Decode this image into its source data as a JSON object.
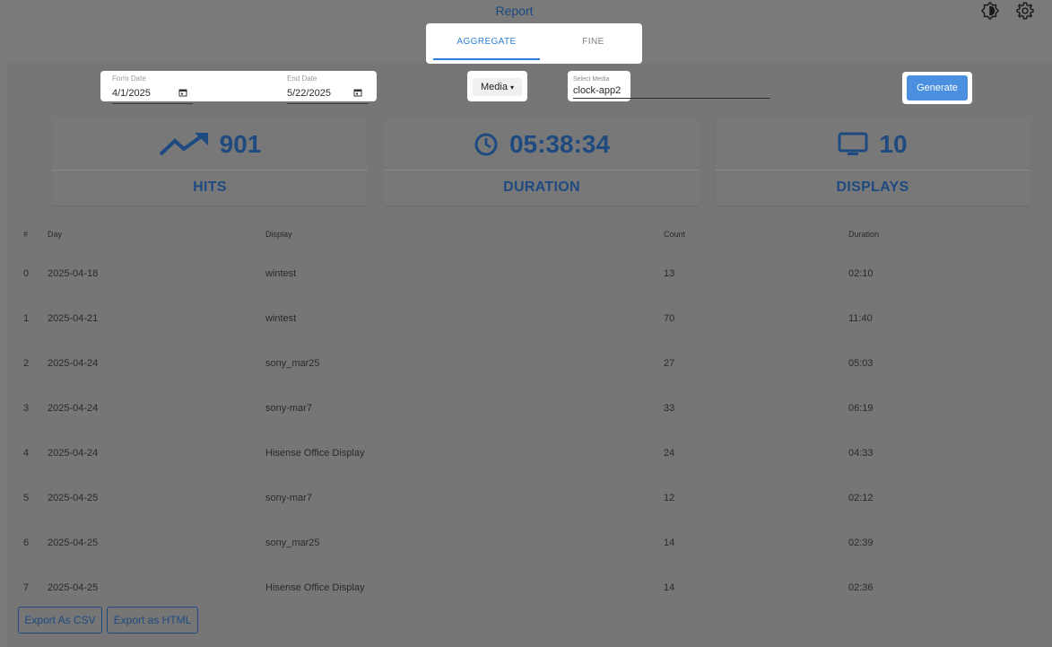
{
  "header": {
    "title": "Report",
    "theme_icon": "brightness-icon",
    "settings_icon": "gear-icon"
  },
  "tabs": [
    {
      "label": "AGGREGATE",
      "active": true
    },
    {
      "label": "FINE",
      "active": false
    }
  ],
  "filters": {
    "from_date": {
      "label": "Form Date",
      "value": "4/1/2025"
    },
    "end_date": {
      "label": "End Date",
      "value": "5/22/2025"
    },
    "media_type": {
      "value": "Media"
    },
    "select_media": {
      "label": "Select Media",
      "value": "clock-app2"
    },
    "generate_label": "Generate"
  },
  "stats": [
    {
      "icon": "trending-up-icon",
      "value": "901",
      "label": "HITS"
    },
    {
      "icon": "clock-icon",
      "value": "05:38:34",
      "label": "DURATION"
    },
    {
      "icon": "monitor-icon",
      "value": "10",
      "label": "DISPLAYS"
    }
  ],
  "table": {
    "headers": [
      "#",
      "Day",
      "Display",
      "Count",
      "Duration"
    ],
    "rows": [
      [
        "0",
        "2025-04-18",
        "wintest",
        "13",
        "02:10"
      ],
      [
        "1",
        "2025-04-21",
        "wintest",
        "70",
        "11:40"
      ],
      [
        "2",
        "2025-04-24",
        "sony_mar25",
        "27",
        "05:03"
      ],
      [
        "3",
        "2025-04-24",
        "sony-mar7",
        "33",
        "06:19"
      ],
      [
        "4",
        "2025-04-24",
        "Hisense Office Display",
        "24",
        "04:33"
      ],
      [
        "5",
        "2025-04-25",
        "sony-mar7",
        "12",
        "02:12"
      ],
      [
        "6",
        "2025-04-25",
        "sony_mar25",
        "14",
        "02:39"
      ],
      [
        "7",
        "2025-04-25",
        "Hisense Office Display",
        "14",
        "02:36"
      ]
    ]
  },
  "footer": {
    "export_csv_label": "Export As CSV",
    "export_html_label": "Export as HTML"
  },
  "colors": {
    "accent": "#2c7ed8",
    "primary_text": "#1e4a80",
    "button": "#4a8fe0"
  }
}
